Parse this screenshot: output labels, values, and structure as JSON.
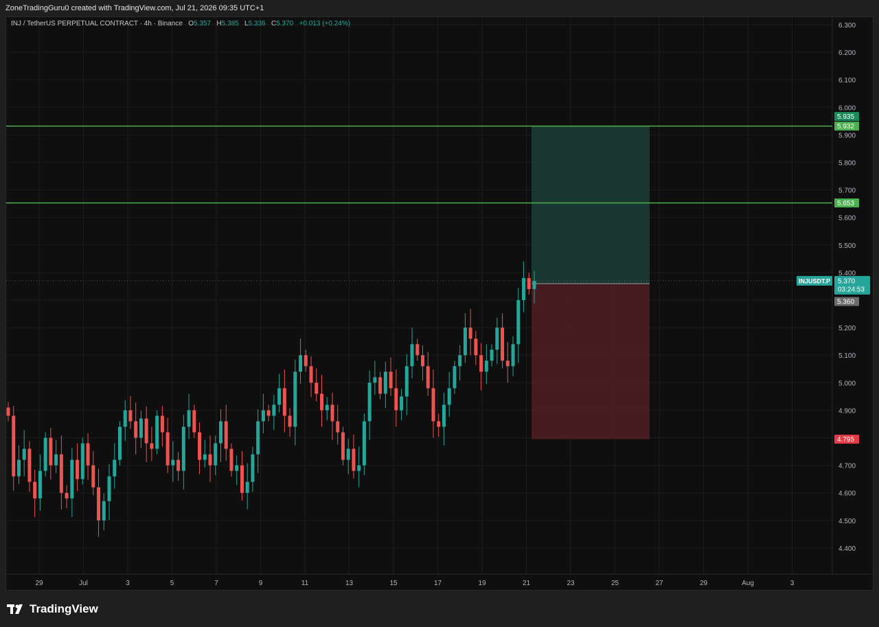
{
  "header": {
    "attribution": "ZoneTradingGuru0 created with TradingView.com, Jul 21, 2026 09:35 UTC+1"
  },
  "legend": {
    "symbol": "INJ / TetherUS PERPETUAL CONTRACT · 4h · Binance",
    "o_label": "O",
    "o": "5.357",
    "h_label": "H",
    "h": "5.385",
    "l_label": "L",
    "l": "5.336",
    "c_label": "C",
    "c": "5.370",
    "change": "+0.013 (+0.24%)"
  },
  "colors": {
    "up": "#26a69a",
    "down": "#ef5350",
    "level": "#4caf50",
    "profit_zone": "#1a3a33",
    "loss_zone": "#4a1e22",
    "grid": "#1c1c1c",
    "axis_text": "#b2b5be"
  },
  "footer": {
    "brand": "TradingView",
    "logo_icon": "tradingview-logo-icon"
  },
  "chart_data": {
    "type": "candlestick",
    "symbol": "INJUSDT.P",
    "interval": "4h",
    "ylim": [
      4.34,
      6.34
    ],
    "y_ticks": [
      "6.300",
      "6.200",
      "6.100",
      "6.000",
      "5.900",
      "5.800",
      "5.700",
      "5.600",
      "5.500",
      "5.400",
      "5.300",
      "5.200",
      "5.100",
      "5.000",
      "4.900",
      "4.800",
      "4.700",
      "4.600",
      "4.500",
      "4.400"
    ],
    "x_ticks": [
      "29",
      "Jul",
      "3",
      "5",
      "7",
      "9",
      "11",
      "13",
      "15",
      "17",
      "19",
      "21",
      "23",
      "25",
      "27",
      "29",
      "Aug",
      "3"
    ],
    "horizontal_levels": [
      {
        "price": 5.932,
        "label": "5.932"
      },
      {
        "price": 5.653,
        "label": "5.653"
      }
    ],
    "price_labels": {
      "target": "5.935",
      "current_symbol": "INJUSDT.P",
      "current": "5.370",
      "countdown": "03:24:53",
      "entry": "5.360",
      "stop": "4.795"
    },
    "position": {
      "entry": 5.36,
      "target": 5.932,
      "stop": 4.795
    },
    "close_prices": [
      4.88,
      4.66,
      4.72,
      4.76,
      4.64,
      4.58,
      4.68,
      4.8,
      4.7,
      4.74,
      4.6,
      4.58,
      4.72,
      4.65,
      4.78,
      4.7,
      4.62,
      4.5,
      4.57,
      4.66,
      4.72,
      4.84,
      4.9,
      4.86,
      4.8,
      4.87,
      4.78,
      4.76,
      4.88,
      4.82,
      4.7,
      4.72,
      4.68,
      4.84,
      4.9,
      4.82,
      4.72,
      4.74,
      4.7,
      4.78,
      4.86,
      4.76,
      4.68,
      4.7,
      4.6,
      4.64,
      4.74,
      4.86,
      4.9,
      4.88,
      4.92,
      4.98,
      4.88,
      4.84,
      5.04,
      5.1,
      5.06,
      5.0,
      4.96,
      4.9,
      4.92,
      4.86,
      4.82,
      4.72,
      4.76,
      4.68,
      4.7,
      4.86,
      5.0,
      5.02,
      4.96,
      5.04,
      4.98,
      4.9,
      4.95,
      5.06,
      5.14,
      5.1,
      5.06,
      4.98,
      4.86,
      4.84,
      4.92,
      4.98,
      5.06,
      5.1,
      5.2,
      5.16,
      5.1,
      5.04,
      5.08,
      5.12,
      5.2,
      5.08,
      5.06,
      5.14,
      5.3,
      5.38,
      5.34,
      5.37
    ]
  }
}
